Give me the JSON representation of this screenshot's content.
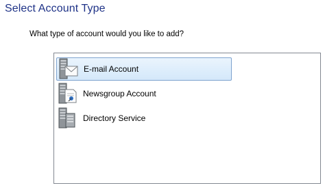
{
  "dialog": {
    "title": "Select Account Type",
    "question": "What type of account would you like to add?"
  },
  "account_types": [
    {
      "label": "E-mail Account",
      "icon": "email-account-icon",
      "selected": true
    },
    {
      "label": "Newsgroup Account",
      "icon": "newsgroup-account-icon",
      "selected": false
    },
    {
      "label": "Directory Service",
      "icon": "directory-service-icon",
      "selected": false
    }
  ],
  "colors": {
    "title": "#1e3287",
    "selection_border": "#7da2ce",
    "selection_fill": "#d4e8fa",
    "list_border": "#828790"
  }
}
